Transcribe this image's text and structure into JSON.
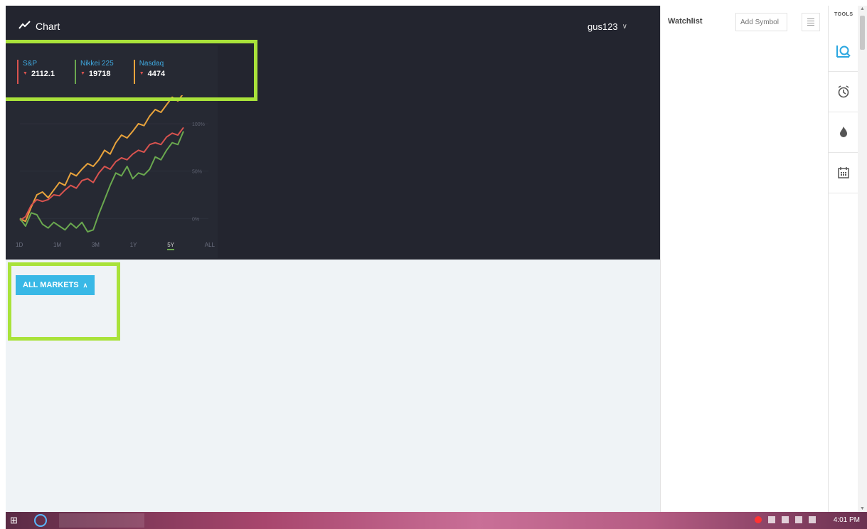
{
  "header": {
    "brand_label": "Chart",
    "user_label": "gus123"
  },
  "tickers": [
    {
      "name": "S&P",
      "value": "2112.1",
      "color": "#d9534f"
    },
    {
      "name": "Nikkei 225",
      "value": "19718",
      "color": "#6aa84f"
    },
    {
      "name": "Nasdaq",
      "value": "4474",
      "color": "#e8a33c"
    }
  ],
  "chart_data": {
    "type": "line",
    "y_tick_labels": [
      "100%",
      "50%",
      "0%"
    ],
    "ylim": [
      -20,
      130
    ],
    "range_options": [
      "1D",
      "1M",
      "3M",
      "1Y",
      "5Y",
      "ALL"
    ],
    "selected_range": "5Y",
    "x_count": 30,
    "series": [
      {
        "color": "#e8a33c",
        "values": [
          0,
          -3,
          12,
          25,
          28,
          22,
          30,
          38,
          35,
          48,
          45,
          52,
          58,
          55,
          62,
          72,
          68,
          80,
          88,
          85,
          92,
          100,
          98,
          108,
          115,
          112,
          120,
          128,
          124,
          132
        ]
      },
      {
        "color": "#d9534f",
        "values": [
          -2,
          2,
          14,
          20,
          18,
          20,
          25,
          24,
          30,
          35,
          32,
          40,
          42,
          38,
          48,
          55,
          52,
          60,
          64,
          62,
          68,
          72,
          70,
          78,
          80,
          78,
          86,
          90,
          88,
          96
        ]
      },
      {
        "color": "#6aa84f",
        "values": [
          0,
          -8,
          6,
          4,
          -6,
          -10,
          -4,
          -8,
          -12,
          -5,
          -10,
          -4,
          -14,
          -12,
          5,
          20,
          35,
          48,
          45,
          55,
          42,
          48,
          46,
          52,
          65,
          62,
          72,
          80,
          78,
          92
        ]
      }
    ]
  },
  "markets": {
    "all_markets_label": "ALL MARKETS"
  },
  "watchlist": {
    "title": "Watchlist",
    "add_placeholder": "Add Symbol"
  },
  "tools": {
    "label": "TOOLS",
    "items": [
      "search-chart-icon",
      "alarm-clock-icon",
      "flame-icon",
      "calendar-icon"
    ]
  },
  "taskbar": {
    "time": "4:01 PM"
  }
}
